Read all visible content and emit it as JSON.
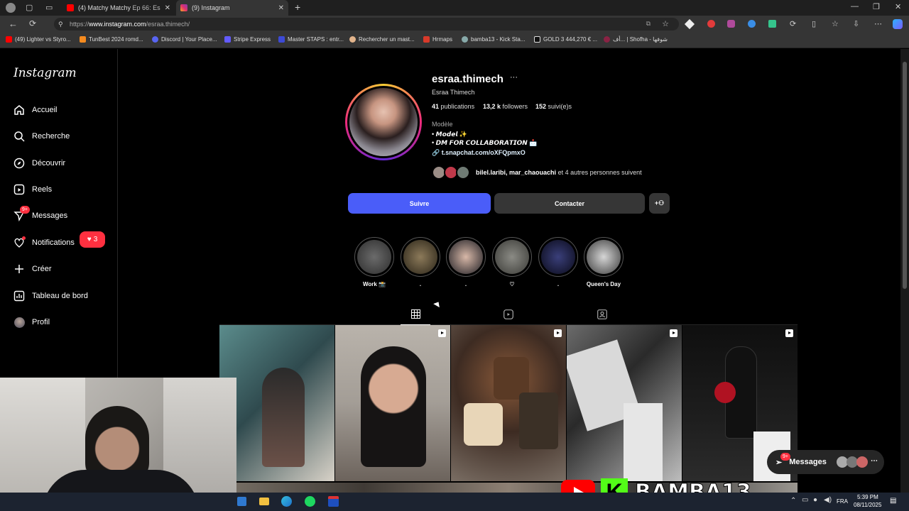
{
  "browser": {
    "tabs": [
      {
        "title": "(4) Matchy Matchy",
        "extra": "Ep 66: Es"
      },
      {
        "title": "(9) Instagram"
      }
    ],
    "url_prefix": "https://",
    "url_host": "www.instagram.com",
    "url_path": "/esraa.thimech/",
    "bookmarks": [
      "(49) Lighter vs Styro...",
      "TunBest 2024 romd...",
      "Discord | Your Place...",
      "Stripe Express",
      "Master STAPS : entr...",
      "Rechercher un mast...",
      "Hrmaps",
      "bamba13 - Kick Sta...",
      "GOLD 3 444,270 € ...",
      "أف... | Shofha - شوفها"
    ]
  },
  "sidebar": {
    "logo": "Instagram",
    "items": [
      {
        "label": "Accueil",
        "icon": "home-icon"
      },
      {
        "label": "Recherche",
        "icon": "search-icon"
      },
      {
        "label": "Découvrir",
        "icon": "compass-icon"
      },
      {
        "label": "Reels",
        "icon": "reels-icon"
      },
      {
        "label": "Messages",
        "icon": "messenger-icon",
        "badge": "9+"
      },
      {
        "label": "Notifications",
        "icon": "heart-icon",
        "count": "3"
      },
      {
        "label": "Créer",
        "icon": "plus-icon"
      },
      {
        "label": "Tableau de bord",
        "icon": "dashboard-icon"
      },
      {
        "label": "Profil",
        "icon": "avatar"
      }
    ]
  },
  "profile": {
    "username": "esraa.thimech",
    "more": "···",
    "full_name": "Esraa Thimech",
    "stats": {
      "posts_count": "41",
      "posts_label": "publications",
      "followers_count": "13,2 k",
      "followers_label": "followers",
      "following_count": "152",
      "following_label": "suivi(e)s"
    },
    "category": "Modèle",
    "bio_line1": "• 𝙈𝙤𝙙𝙚𝙡 ✨",
    "bio_line2": "• 𝘿𝙈 𝙁𝙊𝙍 𝘾𝙊𝙇𝙇𝘼𝘽𝙊𝙍𝘼𝙏𝙄𝙊𝙉 📩",
    "link": "t.snapchat.com/oXFQpmxO",
    "followed_by": "bilel.laribi, mar_chaouachi",
    "followed_by_rest": "et 4 autres personnes suivent",
    "follow_button": "Suivre",
    "contact_button": "Contacter"
  },
  "highlights": [
    {
      "label": "Work 📸"
    },
    {
      "label": "."
    },
    {
      "label": "."
    },
    {
      "label": "♡"
    },
    {
      "label": "."
    },
    {
      "label": "Queen's Day"
    }
  ],
  "messages_pill": {
    "label": "Messages",
    "badge": "9+"
  },
  "taskbar": {
    "lang": "FRA",
    "time": "5:39 PM",
    "date": "08/11/2025"
  },
  "overlay_text": "BAMBA13",
  "colors": {
    "follow": "#4a5df9",
    "contact": "#363636",
    "badge": "#ff3040",
    "link": "#e0f1ff"
  }
}
